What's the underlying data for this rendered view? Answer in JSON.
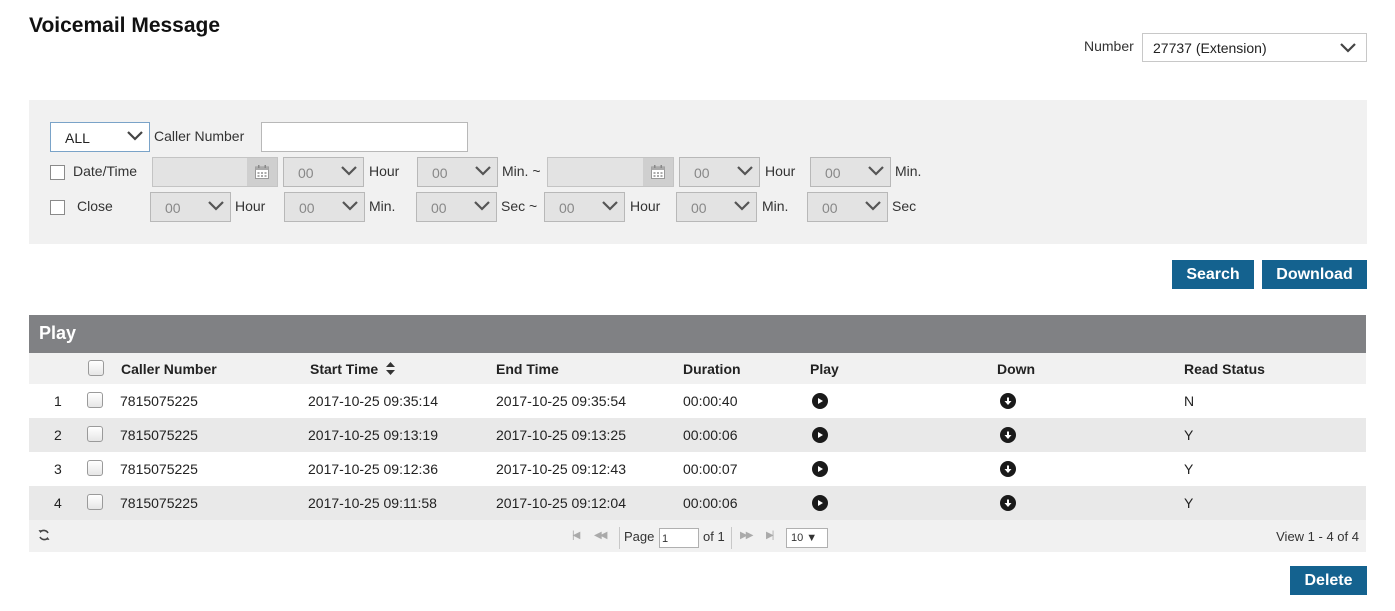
{
  "page": {
    "title": "Voicemail Message",
    "number_label": "Number",
    "number_value": "27737 (Extension)"
  },
  "filters": {
    "type_select": "ALL",
    "caller_number_label": "Caller Number",
    "caller_number_value": "",
    "date_time_label": "Date/Time",
    "close_label": "Close",
    "hour_label": "Hour",
    "min_label": "Min.",
    "min_tilde_label": "Min. ~",
    "sec_label": "Sec",
    "sec_tilde_label": "Sec ~",
    "zero": "00"
  },
  "buttons": {
    "search": "Search",
    "download": "Download",
    "delete": "Delete"
  },
  "grid": {
    "caption": "Play",
    "columns": {
      "caller_number": "Caller Number",
      "start_time": "Start Time",
      "end_time": "End Time",
      "duration": "Duration",
      "play": "Play",
      "down": "Down",
      "read_status": "Read Status"
    },
    "rows": [
      {
        "idx": "1",
        "caller": "7815075225",
        "start": "2017-10-25 09:35:14",
        "end": "2017-10-25 09:35:54",
        "duration": "00:00:40",
        "read": "N"
      },
      {
        "idx": "2",
        "caller": "7815075225",
        "start": "2017-10-25 09:13:19",
        "end": "2017-10-25 09:13:25",
        "duration": "00:00:06",
        "read": "Y"
      },
      {
        "idx": "3",
        "caller": "7815075225",
        "start": "2017-10-25 09:12:36",
        "end": "2017-10-25 09:12:43",
        "duration": "00:00:07",
        "read": "Y"
      },
      {
        "idx": "4",
        "caller": "7815075225",
        "start": "2017-10-25 09:11:58",
        "end": "2017-10-25 09:12:04",
        "duration": "00:00:06",
        "read": "Y"
      }
    ],
    "pager": {
      "page_label": "Page",
      "page_value": "1",
      "of_label": "of 1",
      "rows_per_page": "10 ▼",
      "view_text": "View 1 - 4 of 4"
    }
  },
  "icons": {
    "refresh": "refresh-icon",
    "play": "play-circle-icon",
    "download": "download-circle-icon",
    "calendar": "calendar-icon",
    "sort": "sort-icon",
    "chevron": "chevron-down-icon"
  },
  "colors": {
    "accent": "#14628f",
    "grid_header": "#808184",
    "panel_bg": "#f1f1f1"
  }
}
